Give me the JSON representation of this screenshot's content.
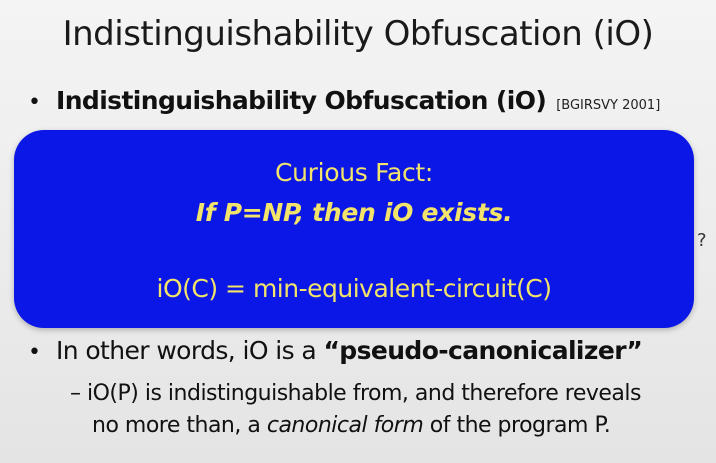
{
  "slide": {
    "title": "Indistinguishability Obfuscation (iO)"
  },
  "bullet1": {
    "marker": "•",
    "bold_text": "Indistinguishability Obfuscation (iO)",
    "citation": "[BGIRSVY 2001]"
  },
  "callout": {
    "line1": "Curious Fact:",
    "line2": "If P=NP, then iO exists.",
    "line3": "iO(C) = min-equivalent-circuit(C)",
    "background_color": "#0b17e6",
    "text_color": "#f2e36a"
  },
  "edge_mark": "?",
  "bullet2": {
    "marker": "•",
    "text_before": "In other words, iO is a ",
    "bold_text": "“pseudo-canonicalizer”"
  },
  "sub_bullet": {
    "dash": "–",
    "line1": "iO(P) is indistinguishable from, and therefore reveals",
    "line2_before": "no more than, a ",
    "line2_italic": "canonical form",
    "line2_after": " of the program P."
  }
}
